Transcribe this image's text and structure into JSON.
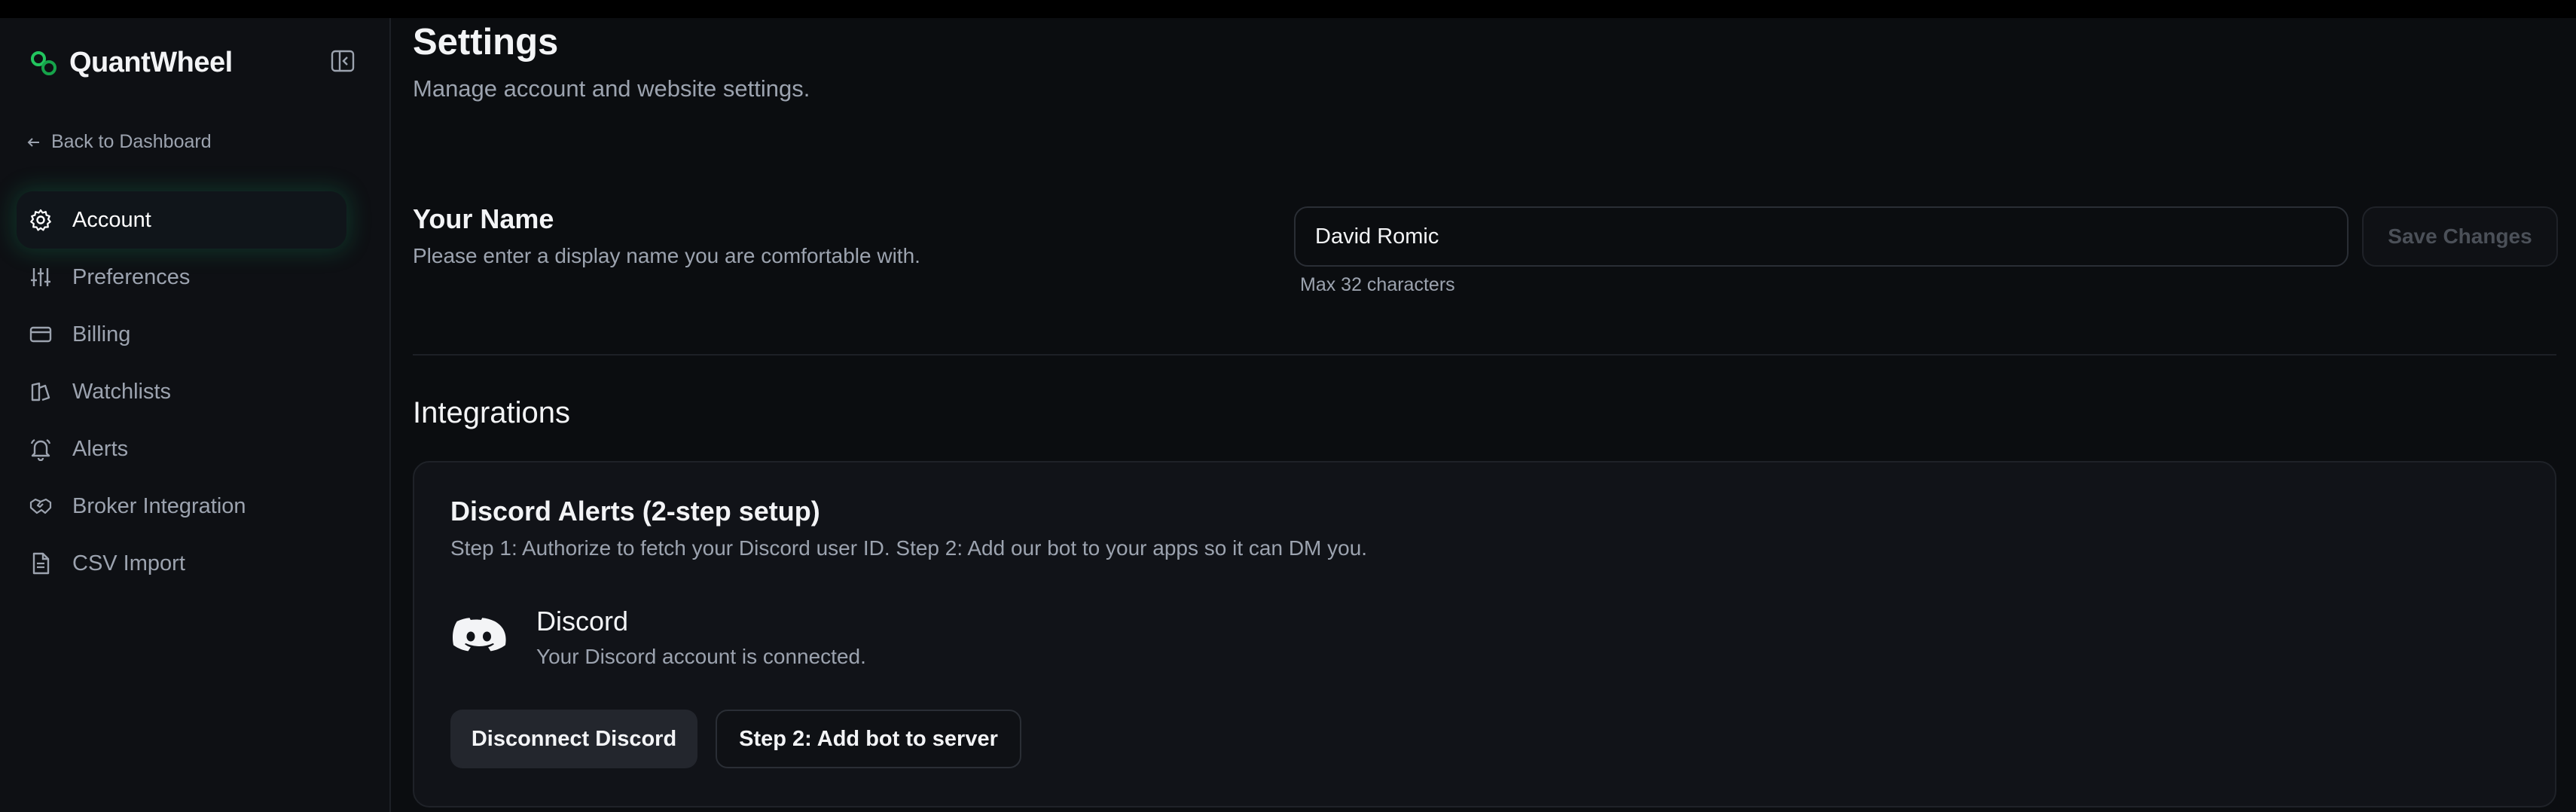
{
  "app": {
    "name": "QuantWheel",
    "brand_color": "#22c55e"
  },
  "sidebar": {
    "back_label": "Back to Dashboard",
    "items": [
      {
        "label": "Account",
        "icon": "gear-icon",
        "active": true
      },
      {
        "label": "Preferences",
        "icon": "sliders-icon",
        "active": false
      },
      {
        "label": "Billing",
        "icon": "credit-card-icon",
        "active": false
      },
      {
        "label": "Watchlists",
        "icon": "watchlist-icon",
        "active": false
      },
      {
        "label": "Alerts",
        "icon": "bell-icon",
        "active": false
      },
      {
        "label": "Broker Integration",
        "icon": "handshake-icon",
        "active": false
      },
      {
        "label": "CSV Import",
        "icon": "file-icon",
        "active": false
      }
    ]
  },
  "page": {
    "title": "Settings",
    "subtitle": "Manage account and website settings."
  },
  "name_section": {
    "title": "Your Name",
    "description": "Please enter a display name you are comfortable with.",
    "input_value": "David Romic",
    "hint": "Max 32 characters",
    "save_label": "Save Changes"
  },
  "integrations": {
    "title": "Integrations",
    "discord_card": {
      "title": "Discord Alerts (2-step setup)",
      "description": "Step 1: Authorize to fetch your Discord user ID. Step 2: Add our bot to your apps so it can DM you.",
      "service_name": "Discord",
      "status": "Your Discord account is connected.",
      "disconnect_label": "Disconnect Discord",
      "add_bot_label": "Step 2: Add bot to server"
    }
  }
}
